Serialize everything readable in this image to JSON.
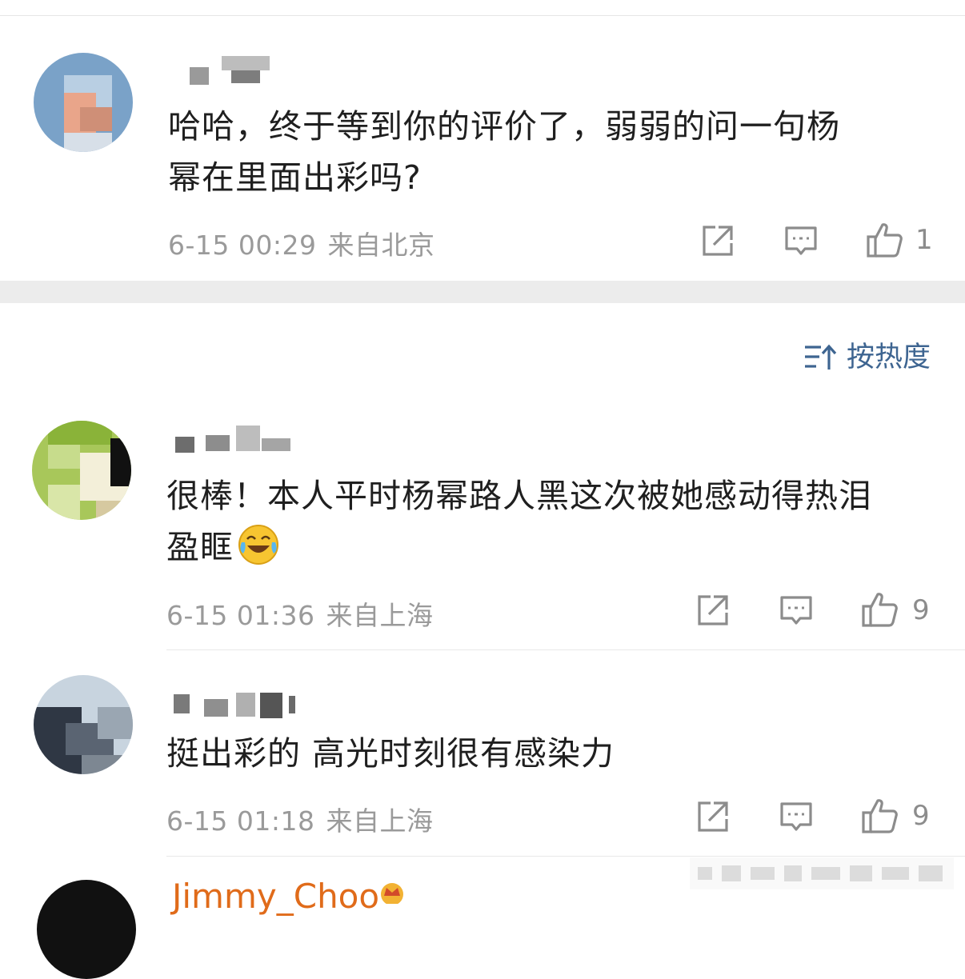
{
  "comments": [
    {
      "text_line1": "哈哈，终于等到你的评价了，弱弱的问一句杨",
      "text_line2": "幂在里面出彩吗?",
      "time": "6-15 00:29",
      "location": "来自北京",
      "likes": "1"
    },
    {
      "text_line1": "很棒！本人平时杨幂路人黑这次被她感动得热泪",
      "text_line2": "盈眶",
      "emoji": "laughing-crying-emoji",
      "time": "6-15 01:36",
      "location": "来自上海",
      "likes": "9"
    },
    {
      "text_line1": "挺出彩的 高光时刻很有感染力",
      "time": "6-15 01:18",
      "location": "来自上海",
      "likes": "9"
    }
  ],
  "sort": {
    "label": "按热度",
    "icon": "sort-icon"
  },
  "next_comment": {
    "username": "Jimmy_Choo"
  },
  "colors": {
    "accent": "#3e6591",
    "meta_gray": "#9a9a9a",
    "divider": "#e8e8e8",
    "band": "#ececec",
    "vip_name": "#e06b1a"
  },
  "icons": [
    "share-icon",
    "comment-icon",
    "thumbs-up-icon"
  ]
}
